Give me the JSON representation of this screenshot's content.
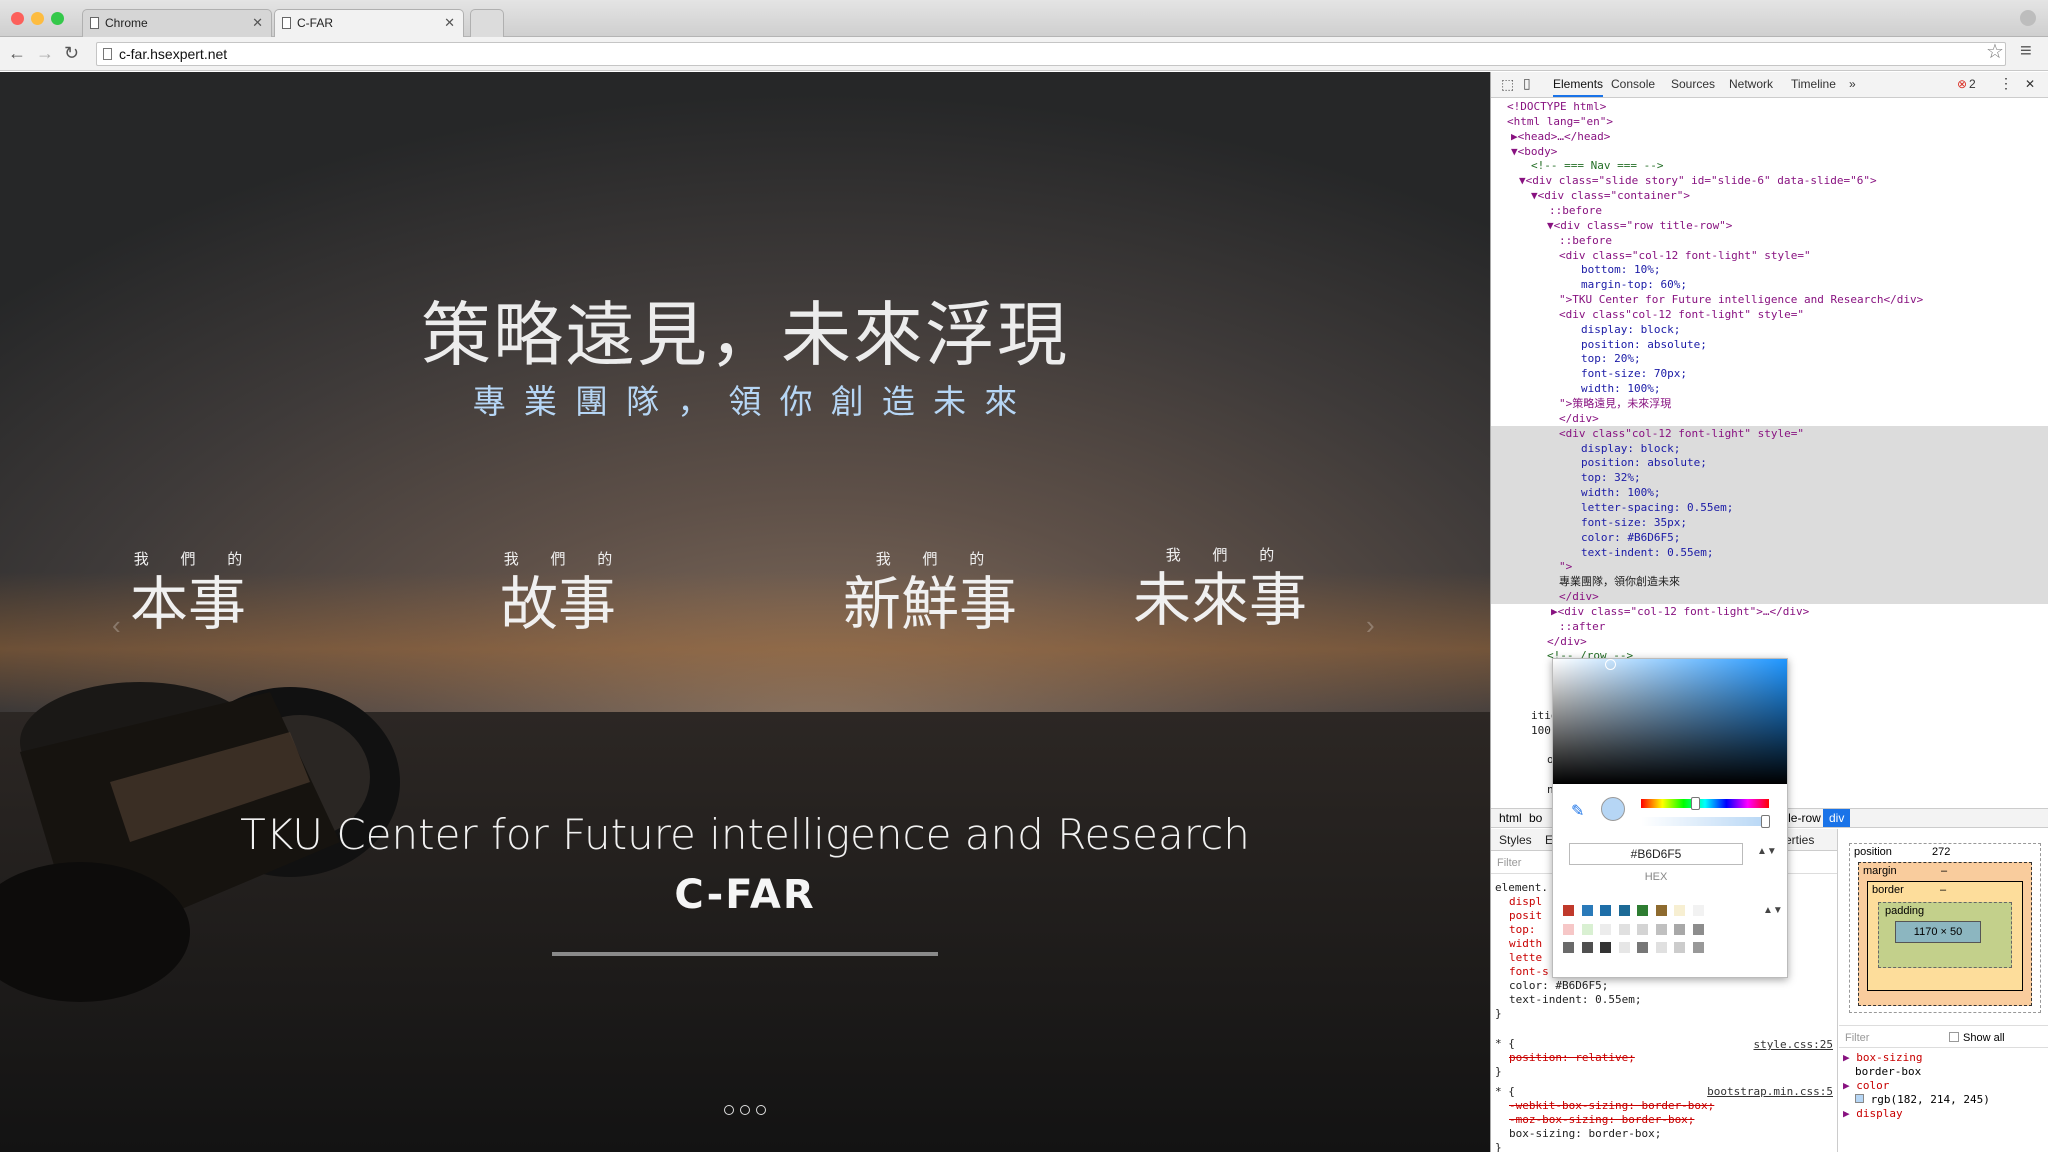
{
  "browser": {
    "tabs": [
      {
        "label": "Chrome"
      },
      {
        "label": "C-FAR"
      }
    ],
    "url": "c-far.hsexpert.net"
  },
  "page": {
    "headline": "策略遠見，未來浮現",
    "subheadline": "專業團隊，領你創造未來",
    "categories": [
      {
        "small": "我 們 的",
        "large": "本事"
      },
      {
        "small": "我 們 的",
        "large": "故事"
      },
      {
        "small": "我 們 的",
        "large": "新鮮事"
      },
      {
        "small": "我 們 的",
        "large": "未來事"
      }
    ],
    "center_name": "TKU Center for Future intelligence and Research",
    "acronym": "C-FAR",
    "slide_indicators": 3
  },
  "devtools": {
    "tabs": [
      "Elements",
      "Console",
      "Sources",
      "Network",
      "Timeline",
      "»"
    ],
    "error_count": "2",
    "breadcrumbs": [
      "html",
      "bo",
      "ner",
      "div.row.title-row",
      "div"
    ],
    "dom_lines": [
      "<!DOCTYPE html>",
      "<html lang=\"en\">",
      "▶<head>…</head>",
      "▼<body>",
      "<!-- === Nav === -->",
      "▼<div class=\"slide story\" id=\"slide-6\" data-slide=\"6\">",
      "▼<div class=\"container\">",
      "::before",
      "▼<div class=\"row title-row\">",
      "::before",
      "<div class=\"col-12 font-light\" style=\"",
      "bottom: 10%;",
      "margin-top: 60%;",
      "\">TKU Center for Future intelligence and Research</div>",
      "<div class\"col-12 font-light\" style=\"",
      "display: block;",
      "position: absolute;",
      "top: 20%;",
      "font-size: 70px;",
      "width: 100%;",
      "\">策略遠見，未來浮現",
      "</div>",
      "<div class\"col-12 font-light\" style=\"",
      "display: block;",
      "position: absolute;",
      "top: 32%;",
      "width: 100%;",
      "letter-spacing: 0.55em;",
      "font-size: 35px;",
      "color: #B6D6F5;",
      "text-indent: 0.55em;",
      "\">",
      "專業團隊，領你創造未來",
      "</div>",
      "▶<div class=\"col-12 font-light\">…</div>",
      "::after",
      "</div>",
      "<!-- /row -->",
      "",
      "",
      "",
      "ition: absolute; top: 0; width:",
      "100",
      "",
      "ow\">",
      "",
      "n-sm\">&nbsp;</div>-->"
    ],
    "styles_tabs": [
      "Styles",
      "E",
      "erties"
    ],
    "filter_placeholder": "Filter",
    "style_lines": [
      "element.",
      "displ",
      "posit",
      "top:",
      "width",
      "lette",
      "font-s",
      "color: #B6D6F5;",
      "text-indent: 0.55em;",
      "}",
      "* {",
      "position: relative;",
      "}",
      "* {",
      "-webkit-box-sizing: border-box;",
      "-moz-box-sizing: border-box;",
      "box-sizing: border-box;",
      "}"
    ],
    "style_sources": [
      "style.css:25",
      "bootstrap.min.css:5"
    ],
    "box_model": {
      "position_label": "position",
      "position_value": "272",
      "margin_label": "margin",
      "border_label": "border",
      "padding_label": "padding",
      "content": "1170 × 50",
      "dash": "–"
    },
    "computed_filter": "Filter",
    "show_all": "Show all",
    "computed": [
      {
        "prop": "box-sizing",
        "value": "border-box"
      },
      {
        "prop": "color",
        "value": "rgb(182, 214, 245)"
      },
      {
        "prop": "display",
        "value": ""
      }
    ]
  },
  "color_picker": {
    "value": "#B6D6F5",
    "format": "HEX",
    "swatches": [
      "#c0392b",
      "#2a7ab9",
      "#1e6ea8",
      "#1d6a96",
      "#2e7d32",
      "#8e6b2f",
      "#f7efd2",
      "#f2f2f2",
      "#f6c7c7",
      "#d9f0d2",
      "#ececec",
      "#e0e0e0",
      "#d4d4d4",
      "#c0c0c0",
      "#a8a8a8",
      "#8d8d8d",
      "#6a6a6a",
      "#505050",
      "#333333",
      "#e6e6e6",
      "#777777",
      "#e0e0e0",
      "#cccccc",
      "#999999"
    ]
  },
  "colors": {
    "subheadline": "#B6D6F5",
    "selection": "#dcdcdc",
    "breadcrumb_active": "#1a73e8",
    "error": "#d93025"
  }
}
